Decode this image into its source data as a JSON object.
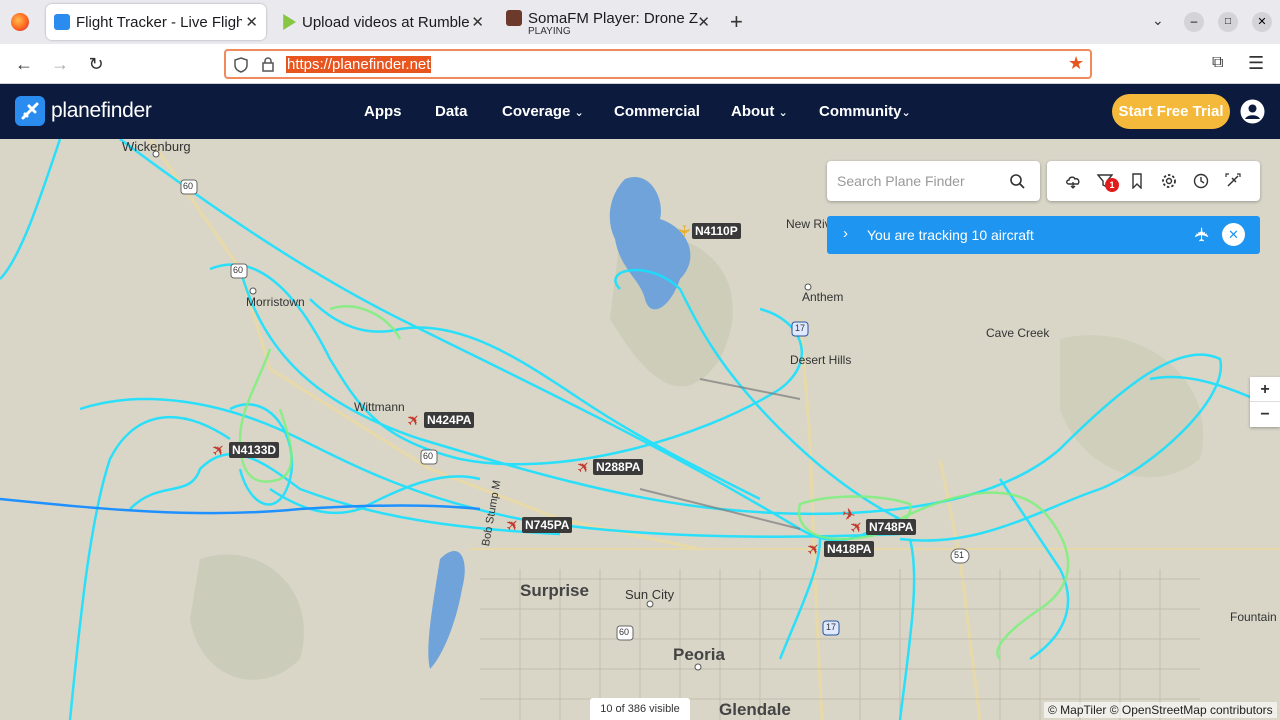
{
  "browser": {
    "tabs": [
      {
        "title": "Flight Tracker - Live Flight",
        "active": true
      },
      {
        "title": "Upload videos at Rumble",
        "active": false
      },
      {
        "title": "SomaFM Player: Drone Zo",
        "subtitle": "PLAYING",
        "active": false
      }
    ],
    "url": "https://planefinder.net"
  },
  "site": {
    "logo": "planefinder",
    "menu": [
      "Apps",
      "Data",
      "Coverage",
      "Commercial",
      "About",
      "Community"
    ],
    "trial_button": "Start Free Trial"
  },
  "map": {
    "search_placeholder": "Search Plane Finder",
    "filter_badge": "1",
    "tracking_text": "You are tracking 10 aircraft",
    "visible_count": "10 of 386 visible",
    "attribution": "© MapTiler © OpenStreetMap contributors",
    "zoom_in": "+",
    "zoom_out": "−",
    "places": {
      "wickenburg": "Wickenburg",
      "morristown": "Morristown",
      "wittmann": "Wittmann",
      "anthem": "Anthem",
      "new_river": "New Riv",
      "cave_creek": "Cave Creek",
      "desert_hills": "Desert Hills",
      "surprise": "Surprise",
      "sun_city": "Sun City",
      "peoria": "Peoria",
      "glendale": "Glendale",
      "fountain": "Fountain",
      "bob_stump": "Bob Stump M"
    },
    "route_shields": [
      "60",
      "60",
      "60",
      "60",
      "17",
      "17",
      "51"
    ],
    "aircraft": [
      {
        "callsign": "N4110P"
      },
      {
        "callsign": "N424PA"
      },
      {
        "callsign": "N4133D"
      },
      {
        "callsign": "N288PA"
      },
      {
        "callsign": "N745PA"
      },
      {
        "callsign": "N748PA"
      },
      {
        "callsign": "N418PA"
      }
    ]
  }
}
